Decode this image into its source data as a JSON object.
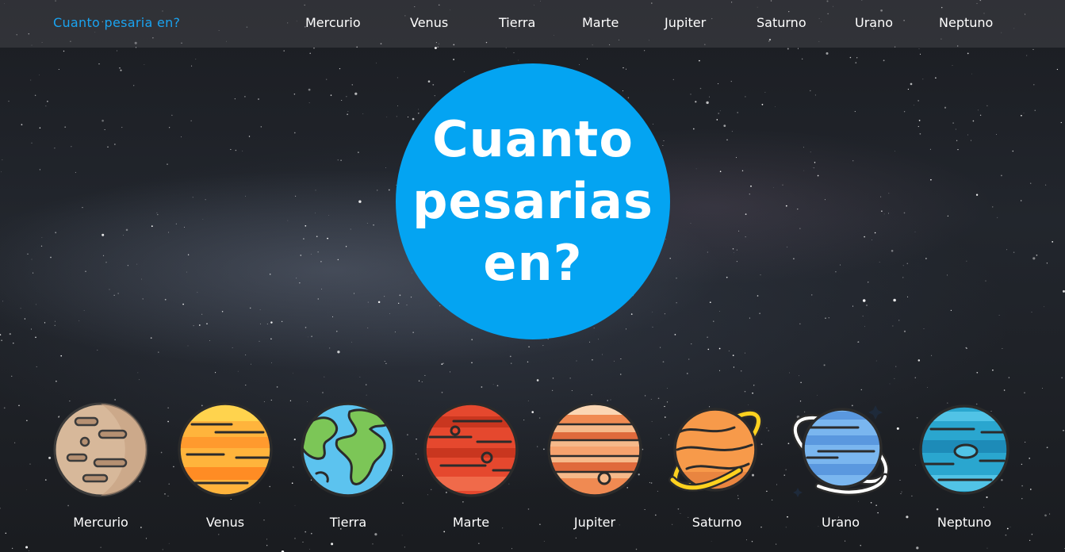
{
  "header": {
    "brand": "Cuanto pesaria en?",
    "nav": [
      {
        "label": "Mercurio"
      },
      {
        "label": "Venus"
      },
      {
        "label": "Tierra"
      },
      {
        "label": "Marte"
      },
      {
        "label": "Jupiter"
      },
      {
        "label": "Saturno"
      },
      {
        "label": "Urano"
      },
      {
        "label": "Neptuno"
      }
    ]
  },
  "hero": {
    "title": "Cuanto pesarias en?"
  },
  "planets": [
    {
      "label": "Mercurio"
    },
    {
      "label": "Venus"
    },
    {
      "label": "Tierra"
    },
    {
      "label": "Marte"
    },
    {
      "label": "Jupiter"
    },
    {
      "label": "Saturno"
    },
    {
      "label": "Urano"
    },
    {
      "label": "Neptuno"
    }
  ],
  "colors": {
    "accent": "#04a4f2",
    "brand_text": "#1aa3f0",
    "background": "#1b1d22"
  }
}
